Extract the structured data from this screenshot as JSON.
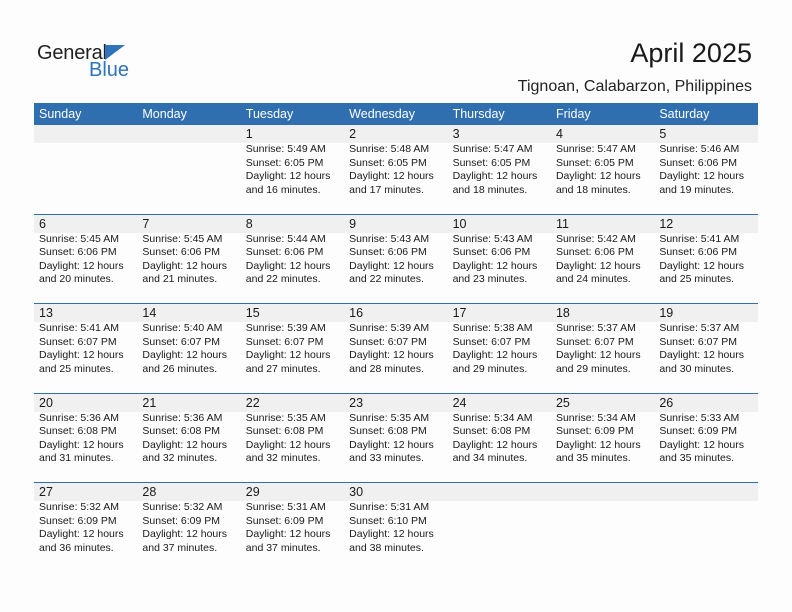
{
  "logo": {
    "word1": "General",
    "word2": "Blue"
  },
  "header": {
    "title": "April 2025",
    "location": "Tignoan, Calabarzon, Philippines"
  },
  "colors": {
    "accent": "#2f6fb0",
    "band": "#f0f0f0"
  },
  "weekdays": [
    "Sunday",
    "Monday",
    "Tuesday",
    "Wednesday",
    "Thursday",
    "Friday",
    "Saturday"
  ],
  "weeks": [
    [
      null,
      null,
      {
        "day": "1",
        "sunrise": "Sunrise: 5:49 AM",
        "sunset": "Sunset: 6:05 PM",
        "daylight1": "Daylight: 12 hours",
        "daylight2": "and 16 minutes."
      },
      {
        "day": "2",
        "sunrise": "Sunrise: 5:48 AM",
        "sunset": "Sunset: 6:05 PM",
        "daylight1": "Daylight: 12 hours",
        "daylight2": "and 17 minutes."
      },
      {
        "day": "3",
        "sunrise": "Sunrise: 5:47 AM",
        "sunset": "Sunset: 6:05 PM",
        "daylight1": "Daylight: 12 hours",
        "daylight2": "and 18 minutes."
      },
      {
        "day": "4",
        "sunrise": "Sunrise: 5:47 AM",
        "sunset": "Sunset: 6:05 PM",
        "daylight1": "Daylight: 12 hours",
        "daylight2": "and 18 minutes."
      },
      {
        "day": "5",
        "sunrise": "Sunrise: 5:46 AM",
        "sunset": "Sunset: 6:06 PM",
        "daylight1": "Daylight: 12 hours",
        "daylight2": "and 19 minutes."
      }
    ],
    [
      {
        "day": "6",
        "sunrise": "Sunrise: 5:45 AM",
        "sunset": "Sunset: 6:06 PM",
        "daylight1": "Daylight: 12 hours",
        "daylight2": "and 20 minutes."
      },
      {
        "day": "7",
        "sunrise": "Sunrise: 5:45 AM",
        "sunset": "Sunset: 6:06 PM",
        "daylight1": "Daylight: 12 hours",
        "daylight2": "and 21 minutes."
      },
      {
        "day": "8",
        "sunrise": "Sunrise: 5:44 AM",
        "sunset": "Sunset: 6:06 PM",
        "daylight1": "Daylight: 12 hours",
        "daylight2": "and 22 minutes."
      },
      {
        "day": "9",
        "sunrise": "Sunrise: 5:43 AM",
        "sunset": "Sunset: 6:06 PM",
        "daylight1": "Daylight: 12 hours",
        "daylight2": "and 22 minutes."
      },
      {
        "day": "10",
        "sunrise": "Sunrise: 5:43 AM",
        "sunset": "Sunset: 6:06 PM",
        "daylight1": "Daylight: 12 hours",
        "daylight2": "and 23 minutes."
      },
      {
        "day": "11",
        "sunrise": "Sunrise: 5:42 AM",
        "sunset": "Sunset: 6:06 PM",
        "daylight1": "Daylight: 12 hours",
        "daylight2": "and 24 minutes."
      },
      {
        "day": "12",
        "sunrise": "Sunrise: 5:41 AM",
        "sunset": "Sunset: 6:06 PM",
        "daylight1": "Daylight: 12 hours",
        "daylight2": "and 25 minutes."
      }
    ],
    [
      {
        "day": "13",
        "sunrise": "Sunrise: 5:41 AM",
        "sunset": "Sunset: 6:07 PM",
        "daylight1": "Daylight: 12 hours",
        "daylight2": "and 25 minutes."
      },
      {
        "day": "14",
        "sunrise": "Sunrise: 5:40 AM",
        "sunset": "Sunset: 6:07 PM",
        "daylight1": "Daylight: 12 hours",
        "daylight2": "and 26 minutes."
      },
      {
        "day": "15",
        "sunrise": "Sunrise: 5:39 AM",
        "sunset": "Sunset: 6:07 PM",
        "daylight1": "Daylight: 12 hours",
        "daylight2": "and 27 minutes."
      },
      {
        "day": "16",
        "sunrise": "Sunrise: 5:39 AM",
        "sunset": "Sunset: 6:07 PM",
        "daylight1": "Daylight: 12 hours",
        "daylight2": "and 28 minutes."
      },
      {
        "day": "17",
        "sunrise": "Sunrise: 5:38 AM",
        "sunset": "Sunset: 6:07 PM",
        "daylight1": "Daylight: 12 hours",
        "daylight2": "and 29 minutes."
      },
      {
        "day": "18",
        "sunrise": "Sunrise: 5:37 AM",
        "sunset": "Sunset: 6:07 PM",
        "daylight1": "Daylight: 12 hours",
        "daylight2": "and 29 minutes."
      },
      {
        "day": "19",
        "sunrise": "Sunrise: 5:37 AM",
        "sunset": "Sunset: 6:07 PM",
        "daylight1": "Daylight: 12 hours",
        "daylight2": "and 30 minutes."
      }
    ],
    [
      {
        "day": "20",
        "sunrise": "Sunrise: 5:36 AM",
        "sunset": "Sunset: 6:08 PM",
        "daylight1": "Daylight: 12 hours",
        "daylight2": "and 31 minutes."
      },
      {
        "day": "21",
        "sunrise": "Sunrise: 5:36 AM",
        "sunset": "Sunset: 6:08 PM",
        "daylight1": "Daylight: 12 hours",
        "daylight2": "and 32 minutes."
      },
      {
        "day": "22",
        "sunrise": "Sunrise: 5:35 AM",
        "sunset": "Sunset: 6:08 PM",
        "daylight1": "Daylight: 12 hours",
        "daylight2": "and 32 minutes."
      },
      {
        "day": "23",
        "sunrise": "Sunrise: 5:35 AM",
        "sunset": "Sunset: 6:08 PM",
        "daylight1": "Daylight: 12 hours",
        "daylight2": "and 33 minutes."
      },
      {
        "day": "24",
        "sunrise": "Sunrise: 5:34 AM",
        "sunset": "Sunset: 6:08 PM",
        "daylight1": "Daylight: 12 hours",
        "daylight2": "and 34 minutes."
      },
      {
        "day": "25",
        "sunrise": "Sunrise: 5:34 AM",
        "sunset": "Sunset: 6:09 PM",
        "daylight1": "Daylight: 12 hours",
        "daylight2": "and 35 minutes."
      },
      {
        "day": "26",
        "sunrise": "Sunrise: 5:33 AM",
        "sunset": "Sunset: 6:09 PM",
        "daylight1": "Daylight: 12 hours",
        "daylight2": "and 35 minutes."
      }
    ],
    [
      {
        "day": "27",
        "sunrise": "Sunrise: 5:32 AM",
        "sunset": "Sunset: 6:09 PM",
        "daylight1": "Daylight: 12 hours",
        "daylight2": "and 36 minutes."
      },
      {
        "day": "28",
        "sunrise": "Sunrise: 5:32 AM",
        "sunset": "Sunset: 6:09 PM",
        "daylight1": "Daylight: 12 hours",
        "daylight2": "and 37 minutes."
      },
      {
        "day": "29",
        "sunrise": "Sunrise: 5:31 AM",
        "sunset": "Sunset: 6:09 PM",
        "daylight1": "Daylight: 12 hours",
        "daylight2": "and 37 minutes."
      },
      {
        "day": "30",
        "sunrise": "Sunrise: 5:31 AM",
        "sunset": "Sunset: 6:10 PM",
        "daylight1": "Daylight: 12 hours",
        "daylight2": "and 38 minutes."
      },
      null,
      null,
      null
    ]
  ]
}
